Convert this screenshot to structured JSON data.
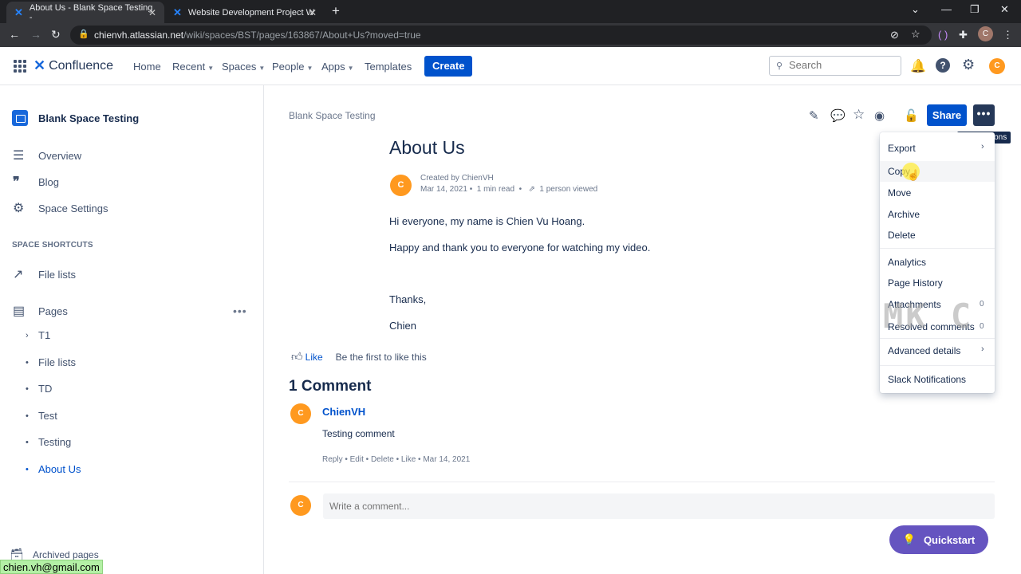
{
  "browser": {
    "tabs": [
      {
        "title": "About Us - Blank Space Testing -",
        "active": true
      },
      {
        "title": "Website Development Project W",
        "active": false
      }
    ],
    "url_host": "chienvh.atlassian.net",
    "url_path": "/wiki/spaces/BST/pages/163867/About+Us?moved=true",
    "profile_initial": "C"
  },
  "topnav": {
    "logo": "Confluence",
    "items": [
      "Home",
      "Recent",
      "Spaces",
      "People",
      "Apps",
      "Templates"
    ],
    "create": "Create",
    "search_placeholder": "Search",
    "avatar": "C"
  },
  "sidebar": {
    "space_name": "Blank Space Testing",
    "nav": [
      {
        "label": "Overview",
        "icon": "overview-icon"
      },
      {
        "label": "Blog",
        "icon": "quote-icon"
      },
      {
        "label": "Space Settings",
        "icon": "gear-icon"
      }
    ],
    "shortcuts_heading": "SPACE SHORTCUTS",
    "shortcut": "File lists",
    "pages_label": "Pages",
    "tree": [
      "T1",
      "File lists",
      "TD",
      "Test",
      "Testing",
      "About Us"
    ],
    "archived": "Archived pages",
    "email_tooltip": "chien.vh@gmail.com"
  },
  "page": {
    "breadcrumb": "Blank Space Testing",
    "title": "About Us",
    "created_by": "Created by ChienVH",
    "date": "Mar 14, 2021",
    "read_time": "1 min read",
    "viewed": "1 person viewed",
    "paragraphs": [
      "Hi everyone, my name is Chien Vu Hoang.",
      "Happy and thank you to everyone for watching my video.",
      "Thanks,",
      "Chien"
    ],
    "share": "Share",
    "tooltip": "More actions",
    "like": "Like",
    "like_first": "Be the first to like this",
    "comments_title": "1 Comment",
    "comment": {
      "author": "ChienVH",
      "text": "Testing comment",
      "actions": [
        "Reply",
        "Edit",
        "Delete",
        "Like",
        "Mar 14, 2021"
      ]
    },
    "comment_placeholder": "Write a comment...",
    "avatar": "C"
  },
  "menu": {
    "items": [
      {
        "label": "Export",
        "submenu": true
      },
      {
        "label": "Copy",
        "highlighted": true
      },
      {
        "label": "Move"
      },
      {
        "label": "Archive"
      },
      {
        "label": "Delete"
      },
      {
        "label": "Analytics"
      },
      {
        "label": "Page History"
      },
      {
        "label": "Attachments",
        "count": "0"
      },
      {
        "label": "Resolved comments",
        "count": "0"
      },
      {
        "label": "Advanced details",
        "submenu": true
      },
      {
        "label": "Slack Notifications"
      }
    ],
    "watermark": "MK C"
  },
  "quickstart": "Quickstart"
}
